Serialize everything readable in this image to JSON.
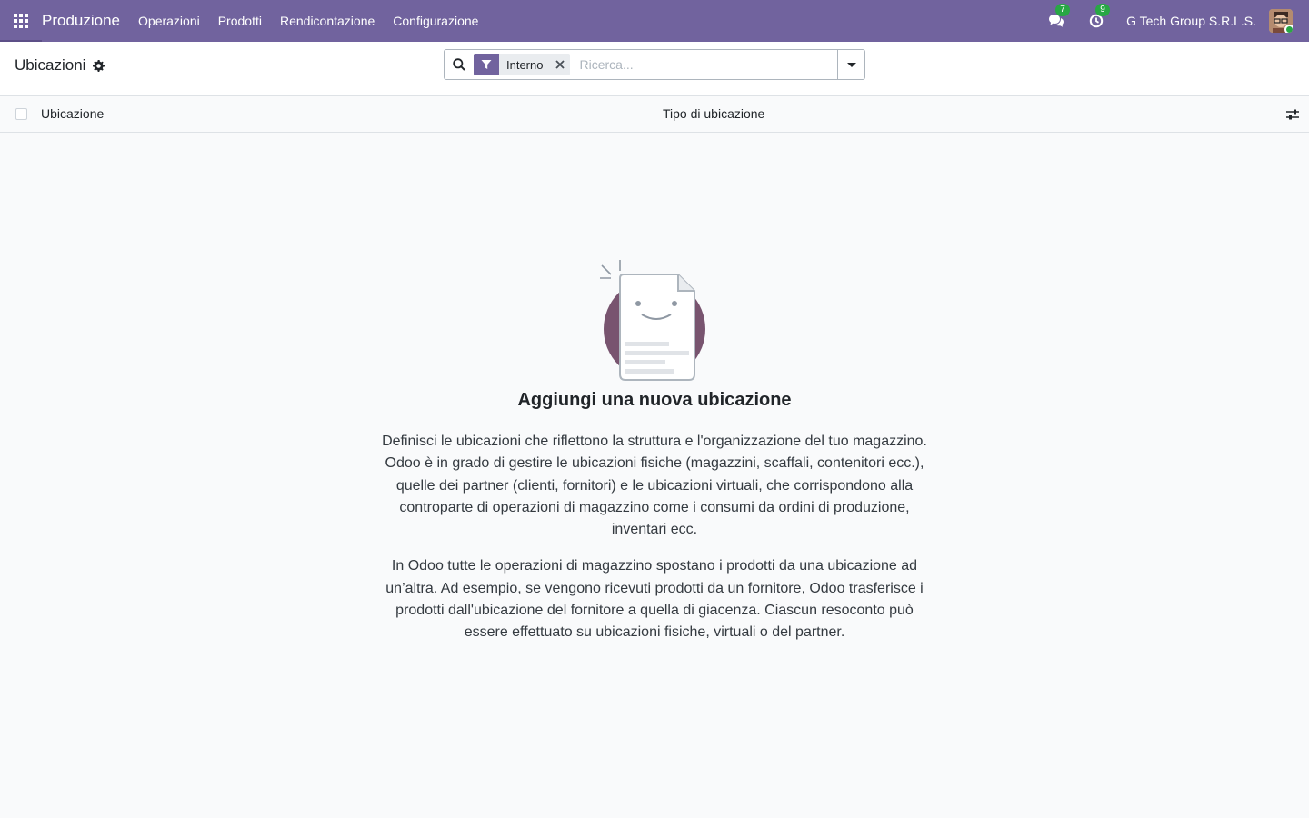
{
  "navbar": {
    "app_name": "Produzione",
    "menu": [
      "Operazioni",
      "Prodotti",
      "Rendicontazione",
      "Configurazione"
    ],
    "messages_count": "7",
    "activities_count": "9",
    "company": "G Tech Group S.R.L.S.",
    "color": "#71639e"
  },
  "control_panel": {
    "title": "Ubicazioni",
    "search": {
      "facet_label": "Interno",
      "placeholder": "Ricerca..."
    }
  },
  "list": {
    "columns": [
      "Ubicazione",
      "Tipo di ubicazione"
    ]
  },
  "empty_state": {
    "title": "Aggiungi una nuova ubicazione",
    "paragraph_1": "Definisci le ubicazioni che riflettono la struttura e l'organizzazione del tuo magazzino. Odoo è in grado di gestire le ubicazioni fisiche (magazzini, scaffali, contenitori ecc.), quelle dei partner (clienti, fornitori) e le ubicazioni virtuali, che corrispondono alla controparte di operazioni di magazzino come i consumi da ordini di produzione, inventari ecc.",
    "paragraph_2": "In Odoo tutte le operazioni di magazzino spostano i prodotti da una ubicazione ad un’altra. Ad esempio, se vengono ricevuti prodotti da un fornitore, Odoo trasferisce i prodotti dall'ubicazione del fornitore a quella di giacenza. Ciascun resoconto può essere effettuato su ubicazioni fisiche, virtuali o del partner."
  }
}
